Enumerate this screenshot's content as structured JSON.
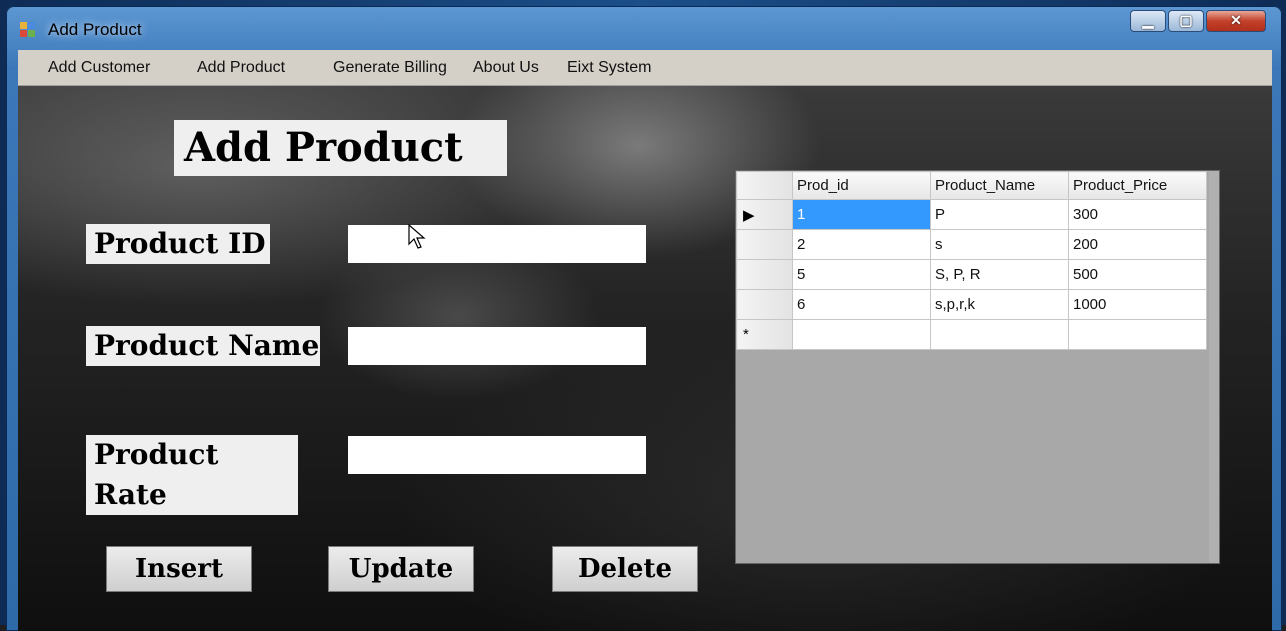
{
  "window": {
    "title": "Add Product",
    "controls": {
      "minimize": "▁",
      "maximize": "▢",
      "close": "✕"
    }
  },
  "menu": {
    "items": [
      {
        "label": "Add Customer"
      },
      {
        "label": "Add Product"
      },
      {
        "label": "Generate Billing"
      },
      {
        "label": "About Us"
      },
      {
        "label": "Eixt System"
      }
    ]
  },
  "form": {
    "heading": "Add Product",
    "product_id_label": "Product ID",
    "product_name_label": "Product Name",
    "product_rate_label": "Product Rate",
    "product_id_value": "",
    "product_name_value": "",
    "product_rate_value": ""
  },
  "buttons": {
    "insert": "Insert",
    "update": "Update",
    "delete": "Delete"
  },
  "grid": {
    "columns": [
      "Prod_id",
      "Product_Name",
      "Product_Price"
    ],
    "rows": [
      {
        "marker": "▶",
        "cells": [
          "1",
          "P",
          "300"
        ]
      },
      {
        "marker": "",
        "cells": [
          "2",
          "s",
          "200"
        ]
      },
      {
        "marker": "",
        "cells": [
          "5",
          "S, P, R",
          "500"
        ]
      },
      {
        "marker": "",
        "cells": [
          "6",
          "s,p,r,k",
          "1000"
        ]
      },
      {
        "marker": "*",
        "cells": [
          "",
          "",
          ""
        ]
      }
    ]
  }
}
